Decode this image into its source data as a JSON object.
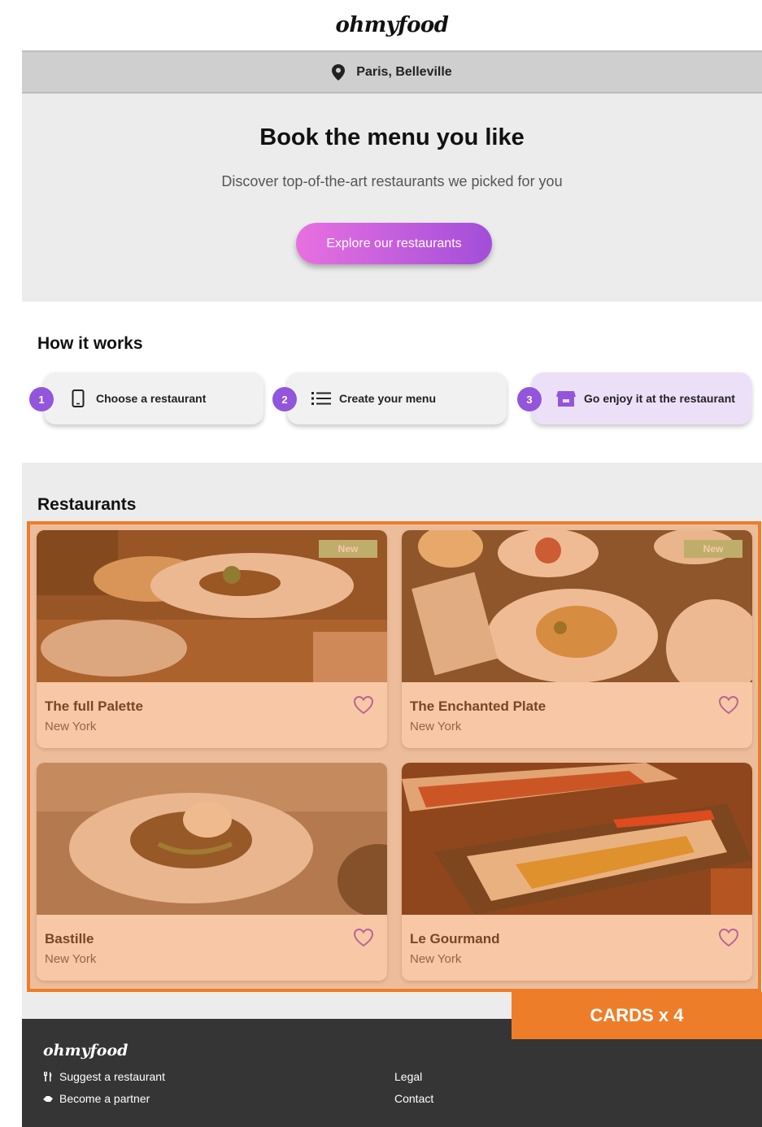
{
  "header": {
    "logo": "ohmyfood"
  },
  "location": {
    "icon": "map-pin-icon",
    "label": "Paris, Belleville"
  },
  "hero": {
    "title": "Book the menu you like",
    "subtitle": "Discover top-of-the-art restaurants we picked for you",
    "cta": "Explore our restaurants"
  },
  "how": {
    "title": "How it works",
    "steps": [
      {
        "number": "1",
        "icon": "smartphone-icon",
        "label": "Choose a restaurant"
      },
      {
        "number": "2",
        "icon": "list-icon",
        "label": "Create your menu"
      },
      {
        "number": "3",
        "icon": "store-icon",
        "label": "Go enjoy it at the restaurant"
      }
    ]
  },
  "restaurants": {
    "title": "Restaurants",
    "cards": [
      {
        "name": "The full Palette",
        "city": "New York",
        "badge": "New"
      },
      {
        "name": "The Enchanted Plate",
        "city": "New York",
        "badge": "New"
      },
      {
        "name": "Bastille",
        "city": "New York"
      },
      {
        "name": "Le Gourmand",
        "city": "New York"
      }
    ]
  },
  "annotation": {
    "label": "CARDS x 4",
    "color": "#ee7d2a"
  },
  "footer": {
    "logo": "ohmyfood",
    "links_left": [
      {
        "icon": "utensils-icon",
        "label": "Suggest a restaurant"
      },
      {
        "icon": "handshake-icon",
        "label": "Become a partner"
      }
    ],
    "links_right": [
      "Legal",
      "Contact"
    ]
  },
  "colors": {
    "accent_purple": "#9355dc",
    "cta_gradient_start": "#e870e0",
    "cta_gradient_end": "#a24ed9",
    "badge_green": "#9ed09a",
    "footer_bg": "#353535"
  }
}
